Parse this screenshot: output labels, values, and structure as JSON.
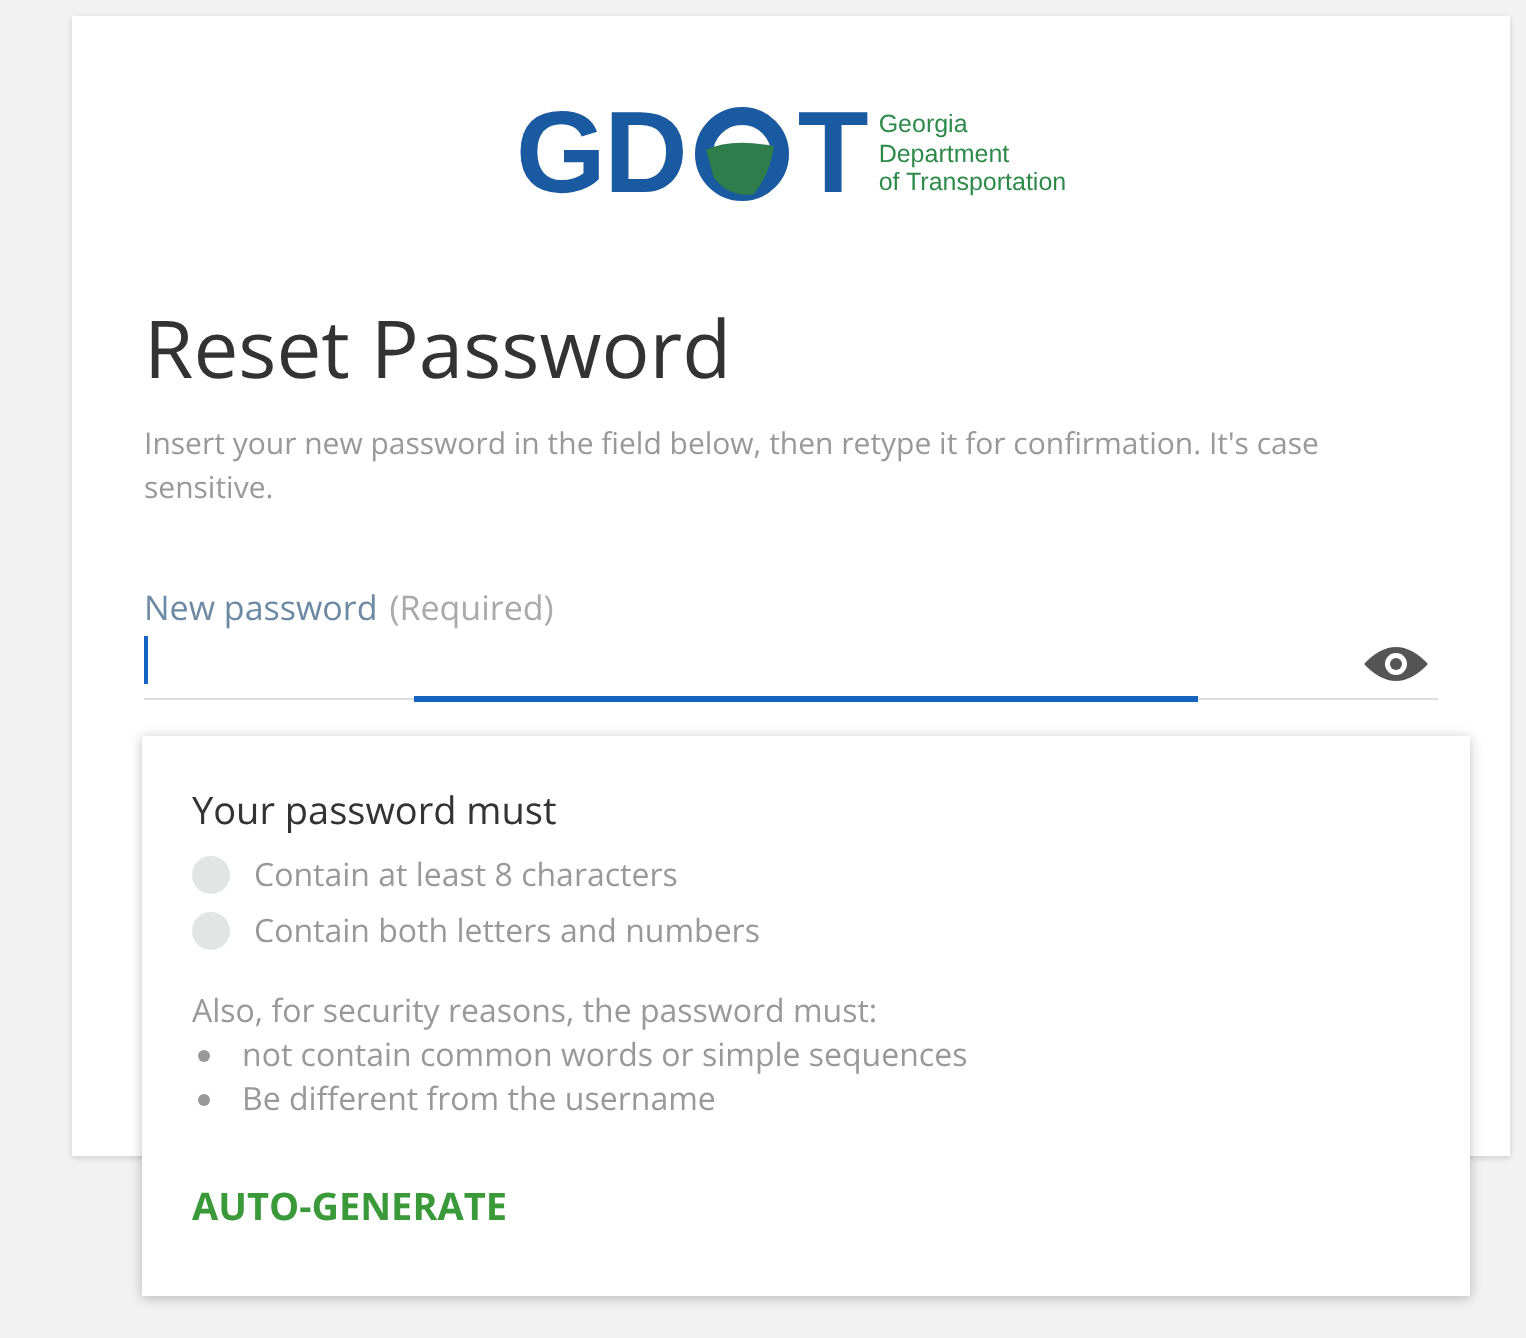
{
  "logo": {
    "lead": "GD",
    "tail": "T",
    "lines": [
      "Georgia",
      "Department",
      "of Transportation"
    ]
  },
  "title": "Reset Password",
  "description": "Insert your new password in the field below, then retype it for confirmation. It's case sensitive.",
  "field": {
    "label": "New password",
    "hint": "(Required)",
    "focused": true
  },
  "popup": {
    "heading": "Your password must",
    "rules": [
      {
        "text": "Contain at least 8 characters",
        "met": false
      },
      {
        "text": "Contain both letters and numbers",
        "met": false
      }
    ],
    "note": "Also, for security reasons, the password must:",
    "bullets": [
      "not contain common words or simple sequences",
      "Be different from the username"
    ],
    "action": "AUTO-GENERATE"
  }
}
